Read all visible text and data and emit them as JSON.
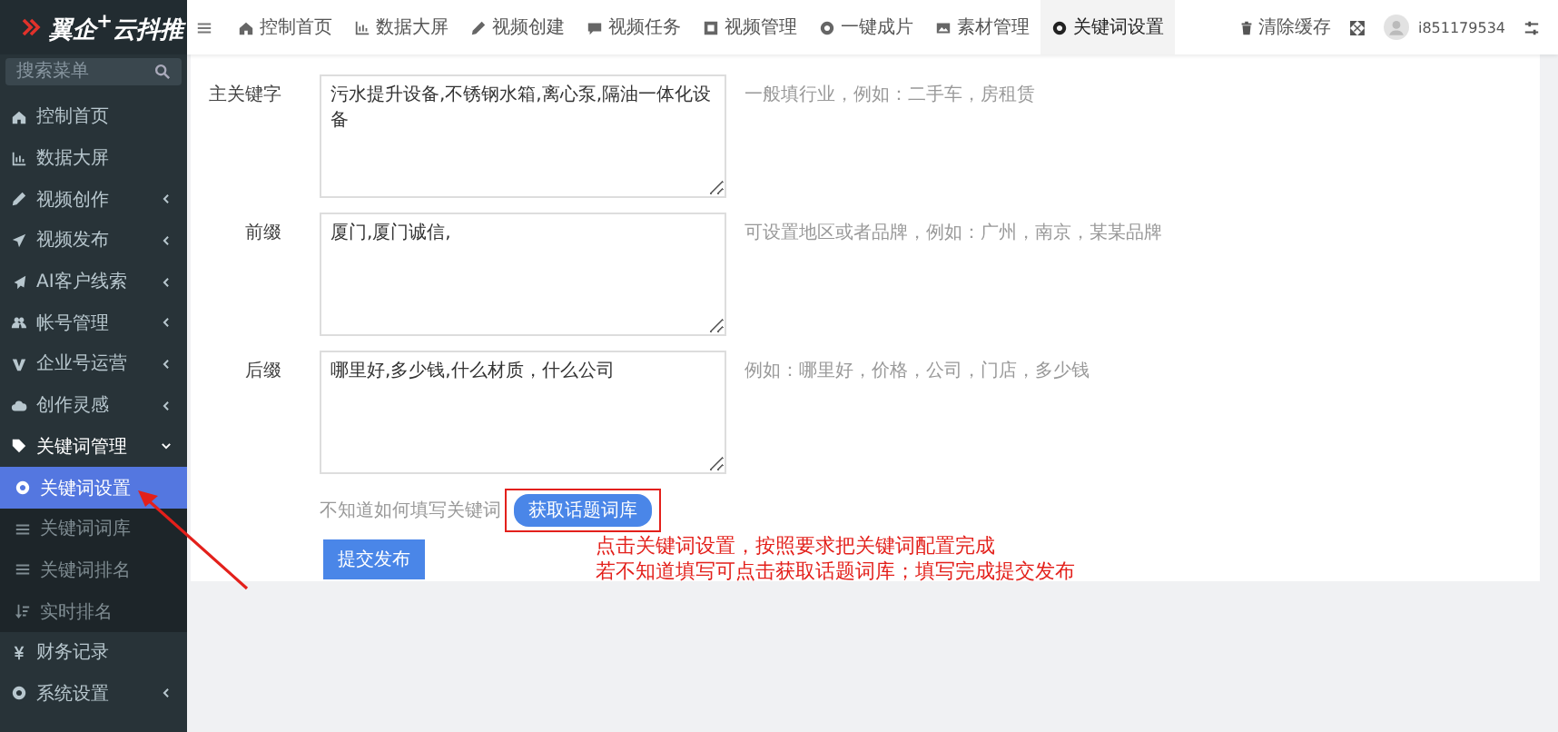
{
  "logo": "翼企$^{+}$云抖推",
  "sidebar": {
    "search": {
      "placeholder": "搜索菜单"
    },
    "items": [
      {
        "label": "控制首页",
        "kind": "link",
        "selected": false
      },
      {
        "label": "数据大屏",
        "kind": "link",
        "selected": false
      },
      {
        "label": "视频创作",
        "kind": "group",
        "expanded": false,
        "selected": false
      },
      {
        "label": "视频发布",
        "kind": "group",
        "expanded": false,
        "selected": false
      },
      {
        "label": "AI客户线索",
        "kind": "group",
        "expanded": false,
        "selected": false
      },
      {
        "label": "帐号管理",
        "kind": "group",
        "expanded": false,
        "selected": false
      },
      {
        "label": "企业号运营",
        "kind": "group",
        "expanded": false,
        "selected": false
      },
      {
        "label": "创作灵感",
        "kind": "group",
        "expanded": false,
        "selected": false
      },
      {
        "label": "关键词管理",
        "kind": "group",
        "expanded": true,
        "selected": false,
        "children": [
          {
            "label": "关键词设置",
            "selected": true
          },
          {
            "label": "关键词词库",
            "selected": false
          },
          {
            "label": "关键词排名",
            "selected": false
          },
          {
            "label": "实时排名",
            "selected": false
          }
        ]
      },
      {
        "label": "财务记录",
        "kind": "link",
        "selected": false
      },
      {
        "label": "系统设置",
        "kind": "group",
        "expanded": false,
        "selected": false
      }
    ]
  },
  "topbar": {
    "tabs": [
      {
        "label": "控制首页",
        "selected": false
      },
      {
        "label": "数据大屏",
        "selected": false
      },
      {
        "label": "视频创建",
        "selected": false
      },
      {
        "label": "视频任务",
        "selected": false
      },
      {
        "label": "视频管理",
        "selected": false
      },
      {
        "label": "一键成片",
        "selected": false
      },
      {
        "label": "素材管理",
        "selected": false
      },
      {
        "label": "关键词设置",
        "selected": true
      }
    ],
    "clear_cache": "清除缓存",
    "username": "i851179534"
  },
  "form": {
    "fields": [
      {
        "label": "主关键字",
        "value": "污水提升设备,不锈钢水箱,离心泵,隔油一体化设备",
        "hint": "一般填行业，例如：二手车，房租赁"
      },
      {
        "label": "前缀",
        "value": "厦门,厦门诚信,",
        "hint": "可设置地区或者品牌，例如：广州，南京，某某品牌"
      },
      {
        "label": "后缀",
        "value": "哪里好,多少钱,什么材质，什么公司",
        "hint": "例如：哪里好，价格，公司，门店，多少钱"
      }
    ],
    "help_text": "不知道如何填写关键词",
    "fetch_button": "获取话题词库",
    "submit_button": "提交发布"
  },
  "annotation": {
    "lines": [
      "点击关键词设置，按照要求把关键词配置完成",
      "若不知道填写可点击获取话题词库；填写完成提交发布"
    ]
  }
}
